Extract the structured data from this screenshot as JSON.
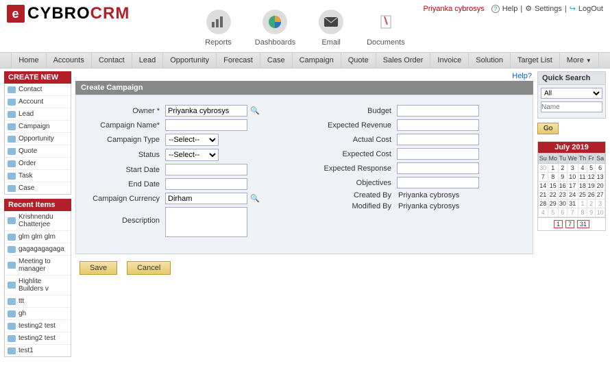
{
  "header": {
    "logo_black": "CYBRO",
    "logo_red": "CRM",
    "user": "Priyanka cybrosys",
    "help": "Help",
    "settings": "Settings",
    "logout": "LogOut"
  },
  "navicons": {
    "reports": "Reports",
    "dashboards": "Dashboards",
    "email": "Email",
    "documents": "Documents"
  },
  "menu": [
    "Home",
    "Accounts",
    "Contact",
    "Lead",
    "Opportunity",
    "Forecast",
    "Case",
    "Campaign",
    "Quote",
    "Sales Order",
    "Invoice",
    "Solution",
    "Target List"
  ],
  "menu_more": "More",
  "create_new": {
    "title": "CREATE NEW",
    "items": [
      "Contact",
      "Account",
      "Lead",
      "Campaign",
      "Opportunity",
      "Quote",
      "Order",
      "Task",
      "Case"
    ]
  },
  "recent": {
    "title": "Recent Items",
    "items": [
      "Krishnendu Chatterjee",
      "glm glm glm",
      "gagagagagaga",
      "Meeting to manager",
      "Highlite Builders v",
      "ttt",
      "gh",
      "testing2 test",
      "testing2 test",
      "test1"
    ]
  },
  "help_link": "Help?",
  "form": {
    "title": "Create Campaign",
    "owner_lbl": "Owner *",
    "owner_val": "Priyanka cybrosys",
    "name_lbl": "Campaign Name*",
    "type_lbl": "Campaign Type",
    "type_sel": "--Select--",
    "status_lbl": "Status",
    "status_sel": "--Select--",
    "start_lbl": "Start Date",
    "end_lbl": "End Date",
    "curr_lbl": "Campaign Currency",
    "curr_val": "Dirham",
    "desc_lbl": "Description",
    "budget_lbl": "Budget",
    "exprev_lbl": "Expected Revenue",
    "actcost_lbl": "Actual Cost",
    "expcost_lbl": "Expected Cost",
    "expresp_lbl": "Expected Response",
    "obj_lbl": "Objectives",
    "createdby_lbl": "Created By",
    "createdby_val": "Priyanka cybrosys",
    "modifiedby_lbl": "Modified By",
    "modifiedby_val": "Priyanka cybrosys",
    "save": "Save",
    "cancel": "Cancel"
  },
  "quick": {
    "title": "Quick Search",
    "all": "All",
    "name_ph": "Name",
    "go": "Go"
  },
  "cal": {
    "title": "July 2019",
    "dow": [
      "Su",
      "Mo",
      "Tu",
      "We",
      "Th",
      "Fr",
      "Sa"
    ],
    "weeks": [
      [
        {
          "d": 30,
          "m": true
        },
        {
          "d": 1
        },
        {
          "d": 2
        },
        {
          "d": 3
        },
        {
          "d": 4
        },
        {
          "d": 5
        },
        {
          "d": 6
        }
      ],
      [
        {
          "d": 7
        },
        {
          "d": 8
        },
        {
          "d": 9
        },
        {
          "d": 10
        },
        {
          "d": 11
        },
        {
          "d": 12
        },
        {
          "d": 13
        }
      ],
      [
        {
          "d": 14
        },
        {
          "d": 15
        },
        {
          "d": 16
        },
        {
          "d": 17
        },
        {
          "d": 18
        },
        {
          "d": 19
        },
        {
          "d": 20
        }
      ],
      [
        {
          "d": 21
        },
        {
          "d": 22
        },
        {
          "d": 23
        },
        {
          "d": 24
        },
        {
          "d": 25
        },
        {
          "d": 26
        },
        {
          "d": 27
        }
      ],
      [
        {
          "d": 28
        },
        {
          "d": 29
        },
        {
          "d": 30
        },
        {
          "d": 31
        },
        {
          "d": 1,
          "m": true
        },
        {
          "d": 2,
          "m": true
        },
        {
          "d": 3,
          "m": true
        }
      ],
      [
        {
          "d": 4,
          "m": true
        },
        {
          "d": 5,
          "m": true
        },
        {
          "d": 6,
          "m": true
        },
        {
          "d": 7,
          "m": true
        },
        {
          "d": 8,
          "m": true
        },
        {
          "d": 9,
          "m": true
        },
        {
          "d": 10,
          "m": true
        }
      ]
    ],
    "foot": [
      "1",
      "7",
      "31"
    ]
  }
}
